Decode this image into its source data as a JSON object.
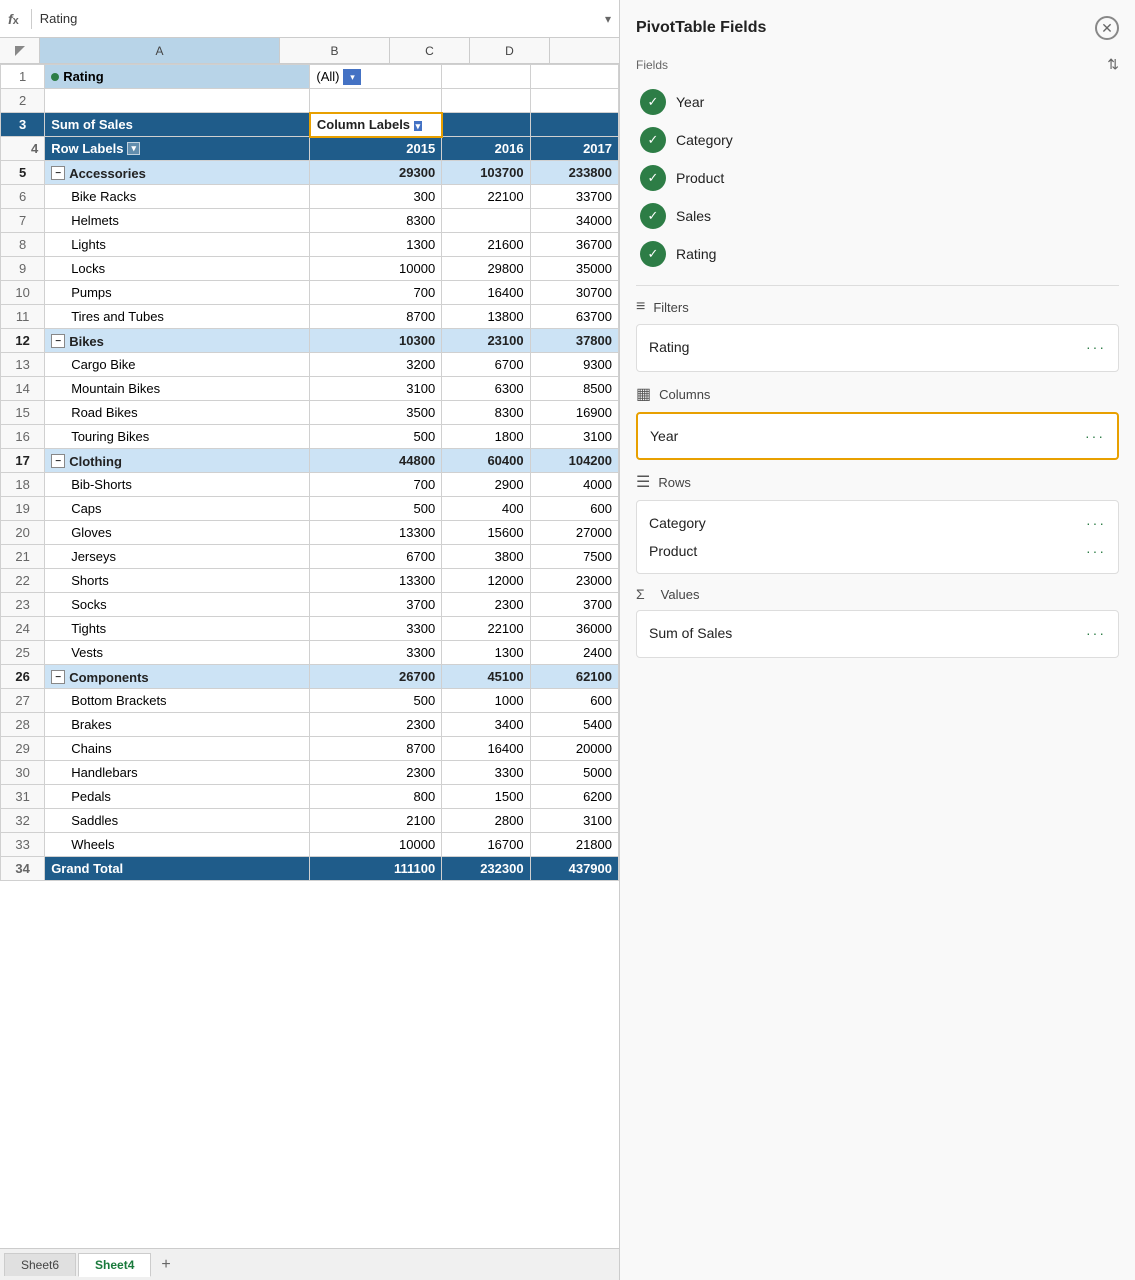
{
  "formula_bar": {
    "icon": "fx",
    "text": "Rating",
    "arrow": "▾"
  },
  "columns": [
    "A",
    "B",
    "C",
    "D"
  ],
  "sheet": {
    "rows": [
      {
        "num": 1,
        "cells": [
          "Rating",
          "(All)",
          "",
          ""
        ],
        "type": "filter"
      },
      {
        "num": 2,
        "cells": [
          "",
          "",
          "",
          ""
        ],
        "type": "empty"
      },
      {
        "num": 3,
        "cells": [
          "Sum of Sales",
          "Column Labels ▾",
          "",
          ""
        ],
        "type": "pivot-header"
      },
      {
        "num": 4,
        "cells": [
          "Row Labels ▾",
          "2015",
          "2016",
          "2017"
        ],
        "type": "year-header"
      },
      {
        "num": 5,
        "cells": [
          "Accessories",
          "29300",
          "103700",
          "233800"
        ],
        "type": "category-summary"
      },
      {
        "num": 6,
        "cells": [
          "Bike Racks",
          "300",
          "22100",
          "33700"
        ],
        "type": "data"
      },
      {
        "num": 7,
        "cells": [
          "Helmets",
          "8300",
          "",
          "34000"
        ],
        "type": "data"
      },
      {
        "num": 8,
        "cells": [
          "Lights",
          "1300",
          "21600",
          "36700"
        ],
        "type": "data"
      },
      {
        "num": 9,
        "cells": [
          "Locks",
          "10000",
          "29800",
          "35000"
        ],
        "type": "data"
      },
      {
        "num": 10,
        "cells": [
          "Pumps",
          "700",
          "16400",
          "30700"
        ],
        "type": "data"
      },
      {
        "num": 11,
        "cells": [
          "Tires and Tubes",
          "8700",
          "13800",
          "63700"
        ],
        "type": "data"
      },
      {
        "num": 12,
        "cells": [
          "Bikes",
          "10300",
          "23100",
          "37800"
        ],
        "type": "category-summary"
      },
      {
        "num": 13,
        "cells": [
          "Cargo Bike",
          "3200",
          "6700",
          "9300"
        ],
        "type": "data"
      },
      {
        "num": 14,
        "cells": [
          "Mountain Bikes",
          "3100",
          "6300",
          "8500"
        ],
        "type": "data"
      },
      {
        "num": 15,
        "cells": [
          "Road Bikes",
          "3500",
          "8300",
          "16900"
        ],
        "type": "data"
      },
      {
        "num": 16,
        "cells": [
          "Touring Bikes",
          "500",
          "1800",
          "3100"
        ],
        "type": "data"
      },
      {
        "num": 17,
        "cells": [
          "Clothing",
          "44800",
          "60400",
          "104200"
        ],
        "type": "category-summary"
      },
      {
        "num": 18,
        "cells": [
          "Bib-Shorts",
          "700",
          "2900",
          "4000"
        ],
        "type": "data"
      },
      {
        "num": 19,
        "cells": [
          "Caps",
          "500",
          "400",
          "600"
        ],
        "type": "data"
      },
      {
        "num": 20,
        "cells": [
          "Gloves",
          "13300",
          "15600",
          "27000"
        ],
        "type": "data"
      },
      {
        "num": 21,
        "cells": [
          "Jerseys",
          "6700",
          "3800",
          "7500"
        ],
        "type": "data"
      },
      {
        "num": 22,
        "cells": [
          "Shorts",
          "13300",
          "12000",
          "23000"
        ],
        "type": "data"
      },
      {
        "num": 23,
        "cells": [
          "Socks",
          "3700",
          "2300",
          "3700"
        ],
        "type": "data"
      },
      {
        "num": 24,
        "cells": [
          "Tights",
          "3300",
          "22100",
          "36000"
        ],
        "type": "data"
      },
      {
        "num": 25,
        "cells": [
          "Vests",
          "3300",
          "1300",
          "2400"
        ],
        "type": "data"
      },
      {
        "num": 26,
        "cells": [
          "Components",
          "26700",
          "45100",
          "62100"
        ],
        "type": "category-summary"
      },
      {
        "num": 27,
        "cells": [
          "Bottom Brackets",
          "500",
          "1000",
          "600"
        ],
        "type": "data"
      },
      {
        "num": 28,
        "cells": [
          "Brakes",
          "2300",
          "3400",
          "5400"
        ],
        "type": "data"
      },
      {
        "num": 29,
        "cells": [
          "Chains",
          "8700",
          "16400",
          "20000"
        ],
        "type": "data"
      },
      {
        "num": 30,
        "cells": [
          "Handlebars",
          "2300",
          "3300",
          "5000"
        ],
        "type": "data"
      },
      {
        "num": 31,
        "cells": [
          "Pedals",
          "800",
          "1500",
          "6200"
        ],
        "type": "data"
      },
      {
        "num": 32,
        "cells": [
          "Saddles",
          "2100",
          "2800",
          "3100"
        ],
        "type": "data"
      },
      {
        "num": 33,
        "cells": [
          "Wheels",
          "10000",
          "16700",
          "21800"
        ],
        "type": "data"
      },
      {
        "num": 34,
        "cells": [
          "Grand Total",
          "111100",
          "232300",
          "437900"
        ],
        "type": "grand-total"
      }
    ]
  },
  "sheet_tabs": [
    "Sheet6",
    "Sheet4"
  ],
  "active_tab": "Sheet4",
  "pivot": {
    "title": "PivotTable Fields",
    "fields_label": "Fields",
    "fields": [
      {
        "name": "Year",
        "checked": true
      },
      {
        "name": "Category",
        "checked": true
      },
      {
        "name": "Product",
        "checked": true
      },
      {
        "name": "Sales",
        "checked": true
      },
      {
        "name": "Rating",
        "checked": true
      }
    ],
    "filters": {
      "label": "Filters",
      "items": [
        {
          "name": "Rating",
          "menu": "···"
        }
      ]
    },
    "columns": {
      "label": "Columns",
      "items": [
        {
          "name": "Year",
          "menu": "···"
        }
      ],
      "highlighted": true
    },
    "rows": {
      "label": "Rows",
      "items": [
        {
          "name": "Category",
          "menu": "···"
        },
        {
          "name": "Product",
          "menu": "···"
        }
      ]
    },
    "values": {
      "label": "Values",
      "items": [
        {
          "name": "Sum of Sales",
          "menu": "···"
        }
      ]
    }
  }
}
